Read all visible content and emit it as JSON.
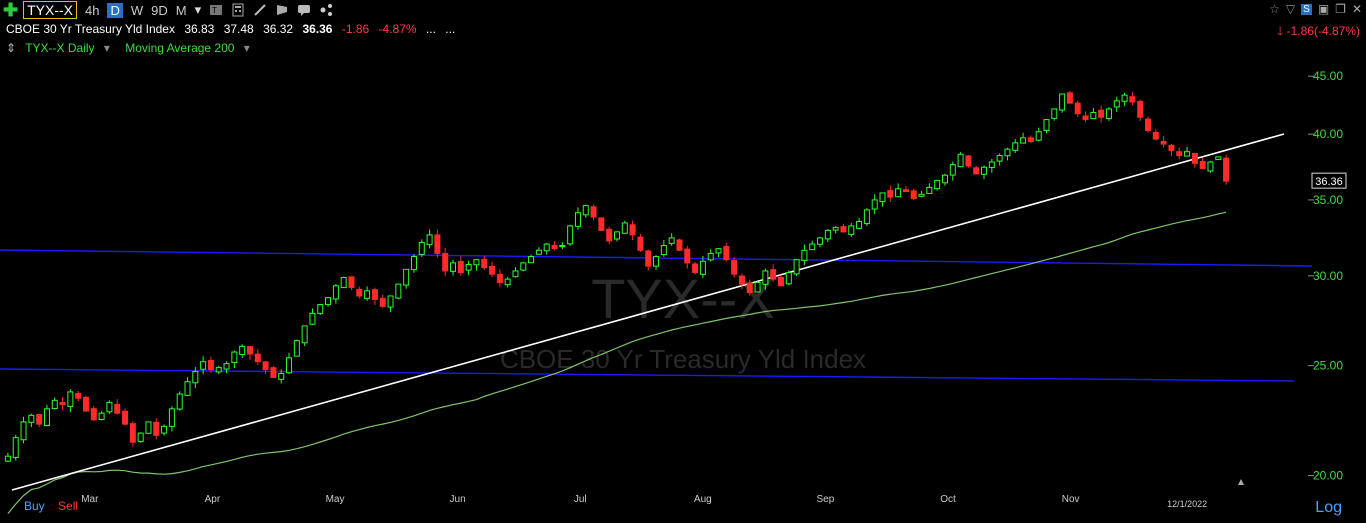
{
  "toolbar": {
    "symbol": "TYX--X",
    "timeframes": [
      "4h",
      "D",
      "W",
      "9D",
      "M"
    ],
    "active_timeframe": "D"
  },
  "quote": {
    "name": "CBOE 30 Yr Treasury Yld Index",
    "open": "36.83",
    "high": "37.48",
    "low": "36.32",
    "close": "36.36",
    "change": "-1.86",
    "change_pct": "-4.87%",
    "ellipsis1": "...",
    "ellipsis2": "...",
    "change_right": "-1.86(-4.87%)"
  },
  "legend": {
    "symbol_period": "TYX--X Daily",
    "indicator": "Moving Average 200"
  },
  "bottom": {
    "buy": "Buy",
    "sell": "Sell",
    "scale": "Log"
  },
  "watermark": {
    "symbol": "TYX--X",
    "name": "CBOE 30 Yr Treasury Yld Index"
  },
  "chart_data": {
    "type": "candlestick",
    "y_scale": "log",
    "ylim": [
      19.5,
      46.5
    ],
    "y_ticks": [
      20,
      25,
      30,
      35,
      40,
      45
    ],
    "y_tick_labels": [
      "20.00",
      "25.00",
      "30.00",
      "35.00",
      "40.00",
      "45.00"
    ],
    "x_labels": [
      "Mar",
      "Apr",
      "May",
      "Jun",
      "Jul",
      "Aug",
      "Sep",
      "Oct",
      "Nov",
      "12/1/2022"
    ],
    "last_price_label": "36.36",
    "colors": {
      "up": "#2bff2b",
      "down": "#ff2b2b",
      "ma": "#7fc46a",
      "trend": "#ffffff",
      "channel": "#1a1aff"
    },
    "closes": [
      20.8,
      21.6,
      22.3,
      22.6,
      22.2,
      22.9,
      23.3,
      23.1,
      23.7,
      23.4,
      22.8,
      22.4,
      22.7,
      23.2,
      22.7,
      22.2,
      21.4,
      21.8,
      22.3,
      21.7,
      22.1,
      22.9,
      23.6,
      24.2,
      24.7,
      25.2,
      24.8,
      24.9,
      25.1,
      25.7,
      26.0,
      25.6,
      25.2,
      24.8,
      24.4,
      24.6,
      25.4,
      26.3,
      27.1,
      27.8,
      28.3,
      28.7,
      29.4,
      29.9,
      29.3,
      28.8,
      29.1,
      28.6,
      28.2,
      28.8,
      29.5,
      30.4,
      31.2,
      32.1,
      32.6,
      31.4,
      30.3,
      30.8,
      30.2,
      30.7,
      31.0,
      30.5,
      30.1,
      29.6,
      29.8,
      30.3,
      30.8,
      31.2,
      31.6,
      32.0,
      31.7,
      31.9,
      33.2,
      34.1,
      34.6,
      33.8,
      32.9,
      32.2,
      32.8,
      33.4,
      32.6,
      31.6,
      30.6,
      31.2,
      31.9,
      32.4,
      31.6,
      30.8,
      30.2,
      30.9,
      31.4,
      31.7,
      31.0,
      30.1,
      29.5,
      29.0,
      29.6,
      30.3,
      29.8,
      29.4,
      30.2,
      31.0,
      31.6,
      32.0,
      32.4,
      32.9,
      33.1,
      32.8,
      33.2,
      33.5,
      34.3,
      35.0,
      35.5,
      35.2,
      35.8,
      35.6,
      35.1,
      35.4,
      35.9,
      36.4,
      36.8,
      37.6,
      38.4,
      37.5,
      36.9,
      37.4,
      37.8,
      38.3,
      38.8,
      39.3,
      39.7,
      39.4,
      40.2,
      41.2,
      42.1,
      43.4,
      42.6,
      41.7,
      41.2,
      41.8,
      41.4,
      42.1,
      42.8,
      43.3,
      42.7,
      41.4,
      40.3,
      39.6,
      39.2,
      38.7,
      38.3,
      38.6,
      37.7,
      37.3,
      37.8,
      38.2,
      36.36
    ]
  }
}
